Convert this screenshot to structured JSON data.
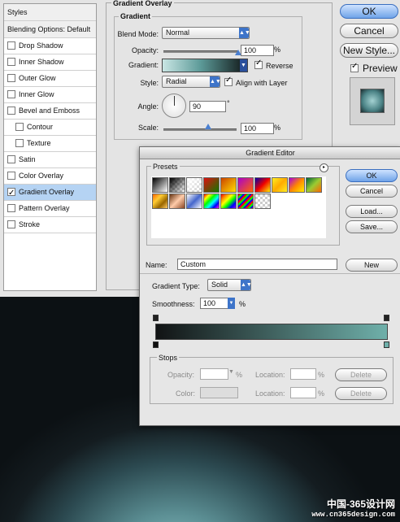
{
  "layer_style": {
    "styles_header": "Styles",
    "blending_options": "Blending Options: Default",
    "items": [
      {
        "label": "Drop Shadow",
        "checked": false
      },
      {
        "label": "Inner Shadow",
        "checked": false
      },
      {
        "label": "Outer Glow",
        "checked": false
      },
      {
        "label": "Inner Glow",
        "checked": false
      },
      {
        "label": "Bevel and Emboss",
        "checked": false
      },
      {
        "label": "Contour",
        "checked": false
      },
      {
        "label": "Texture",
        "checked": false
      },
      {
        "label": "Satin",
        "checked": false
      },
      {
        "label": "Color Overlay",
        "checked": false
      },
      {
        "label": "Gradient Overlay",
        "checked": true,
        "selected": true
      },
      {
        "label": "Pattern Overlay",
        "checked": false
      },
      {
        "label": "Stroke",
        "checked": false
      }
    ],
    "section_title": "Gradient Overlay",
    "subsection_title": "Gradient",
    "blend_mode_label": "Blend Mode:",
    "blend_mode_value": "Normal",
    "opacity_label": "Opacity:",
    "opacity_value": "100",
    "opacity_unit": "%",
    "gradient_label": "Gradient:",
    "reverse_label": "Reverse",
    "style_label": "Style:",
    "style_value": "Radial",
    "align_label": "Align with Layer",
    "angle_label": "Angle:",
    "angle_value": "90",
    "angle_unit": "°",
    "scale_label": "Scale:",
    "scale_value": "100",
    "scale_unit": "%",
    "ok": "OK",
    "cancel": "Cancel",
    "new_style": "New Style...",
    "preview_label": "Preview"
  },
  "gradient_editor": {
    "title": "Gradient Editor",
    "presets_label": "Presets",
    "ok": "OK",
    "cancel": "Cancel",
    "load": "Load...",
    "save": "Save...",
    "name_label": "Name:",
    "name_value": "Custom",
    "new_button": "New",
    "gradient_type_label": "Gradient Type:",
    "gradient_type_value": "Solid",
    "smoothness_label": "Smoothness:",
    "smoothness_value": "100",
    "smoothness_unit": "%",
    "stops_label": "Stops",
    "opacity_label": "Opacity:",
    "location_label": "Location:",
    "color_label": "Color:",
    "pct": "%",
    "delete": "Delete",
    "gradient_start_color": "#111314",
    "gradient_end_color": "#6fb0aa"
  },
  "watermark": {
    "line1": "中国-365设计网",
    "line2": "www.cn365design.com"
  }
}
